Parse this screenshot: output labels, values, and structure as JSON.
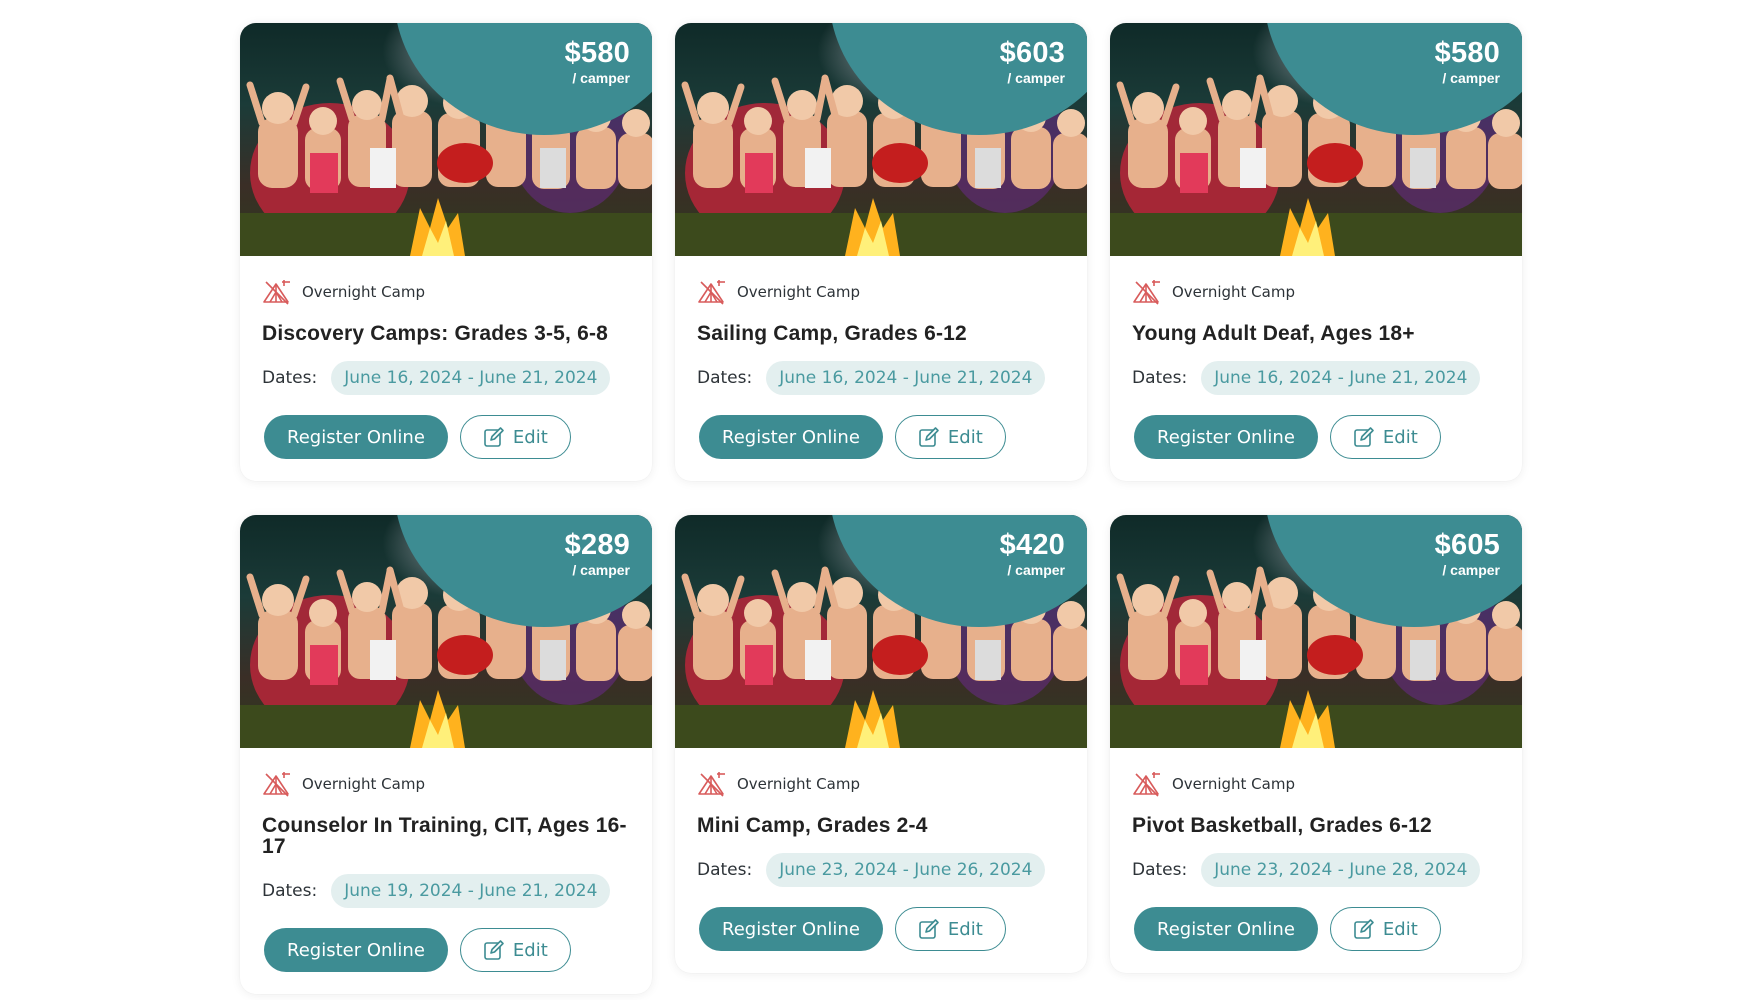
{
  "colors": {
    "accent": "#3d8c92",
    "pill_bg": "#e3efef",
    "pill_text": "#4a9aa0",
    "icon": "#d85b5b"
  },
  "labels": {
    "dates": "Dates:",
    "register": "Register Online",
    "edit": "Edit",
    "price_unit": "/ camper"
  },
  "icons": {
    "camp_type": "campsite-tent-icon",
    "edit": "edit-pencil-icon"
  },
  "cards": [
    {
      "price": "$580",
      "type": "Overnight Camp",
      "title": "Discovery Camps: Grades 3-5, 6-8",
      "dates": "June 16, 2024 - June 21, 2024"
    },
    {
      "price": "$603",
      "type": "Overnight Camp",
      "title": "Sailing Camp, Grades 6-12",
      "dates": "June 16, 2024 - June 21, 2024"
    },
    {
      "price": "$580",
      "type": "Overnight Camp",
      "title": "Young Adult Deaf, Ages 18+",
      "dates": "June 16, 2024 - June 21, 2024"
    },
    {
      "price": "$289",
      "type": "Overnight Camp",
      "title": "Counselor In Training, CIT, Ages 16-17",
      "dates": "June 19, 2024 - June 21, 2024"
    },
    {
      "price": "$420",
      "type": "Overnight Camp",
      "title": "Mini Camp, Grades 2-4",
      "dates": "June 23, 2024 - June 26, 2024"
    },
    {
      "price": "$605",
      "type": "Overnight Camp",
      "title": "Pivot Basketball, Grades 6-12",
      "dates": "June 23, 2024 - June 28, 2024"
    }
  ]
}
